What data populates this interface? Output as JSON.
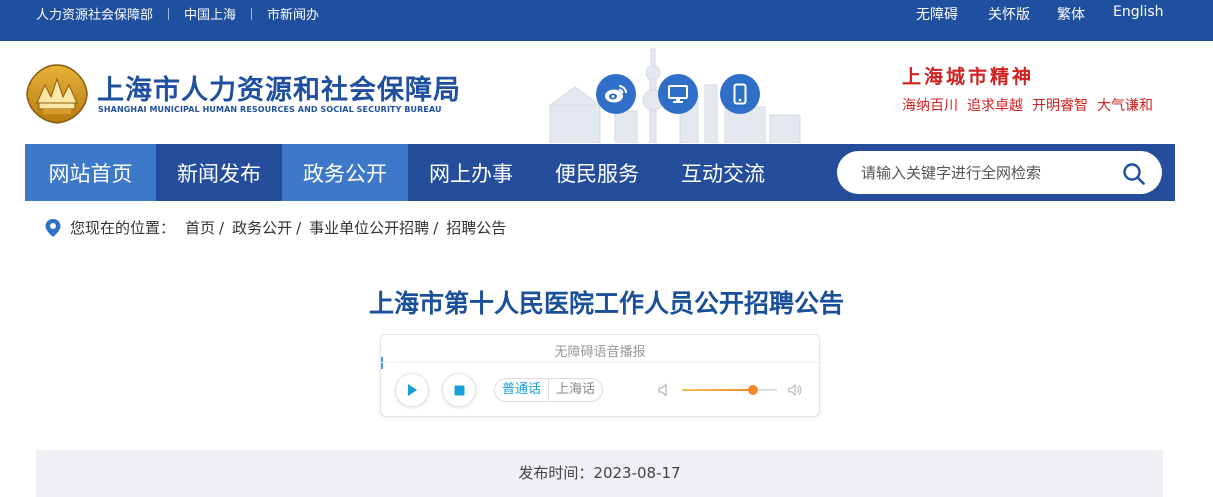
{
  "topbar": {
    "left_links": [
      "人力资源社会保障部",
      "中国上海",
      "市新闻办"
    ],
    "right_links": [
      "无障碍",
      "关怀版",
      "繁体",
      "English"
    ]
  },
  "header": {
    "logo_cn": "上海市人力资源和社会保障局",
    "logo_en": "SHANGHAI MUNICIPAL HUMAN RESOURCES AND SOCIAL SECURITY BUREAU",
    "icons": [
      "weibo-icon",
      "monitor-icon",
      "mobile-icon"
    ],
    "spirit_title": "上海城市精神",
    "spirit_items": [
      "海纳百川",
      "追求卓越",
      "开明睿智",
      "大气谦和"
    ]
  },
  "nav": {
    "items": [
      "网站首页",
      "新闻发布",
      "政务公开",
      "网上办事",
      "便民服务",
      "互动交流"
    ],
    "active_items": [
      "网站首页",
      "政务公开"
    ],
    "search_placeholder": "请输入关键字进行全网检索"
  },
  "breadcrumb": {
    "label": "您现在的位置：",
    "items": [
      "首页",
      "政务公开",
      "事业单位公开招聘",
      "招聘公告"
    ],
    "separator": "/"
  },
  "article": {
    "title": "上海市第十人民医院工作人员公开招聘公告",
    "date_text": "发布时间：2023-08-17"
  },
  "player": {
    "title": "无障碍语音播报",
    "lang_selected": "普通话",
    "lang_other": "上海话",
    "volume_fraction": 0.75
  },
  "colors": {
    "topbar": "#1f4f9f",
    "nav": "#244e9c",
    "nav_active": "#3e78c9",
    "accent_red": "#d21f1f",
    "title_blue": "#1a4f99"
  }
}
